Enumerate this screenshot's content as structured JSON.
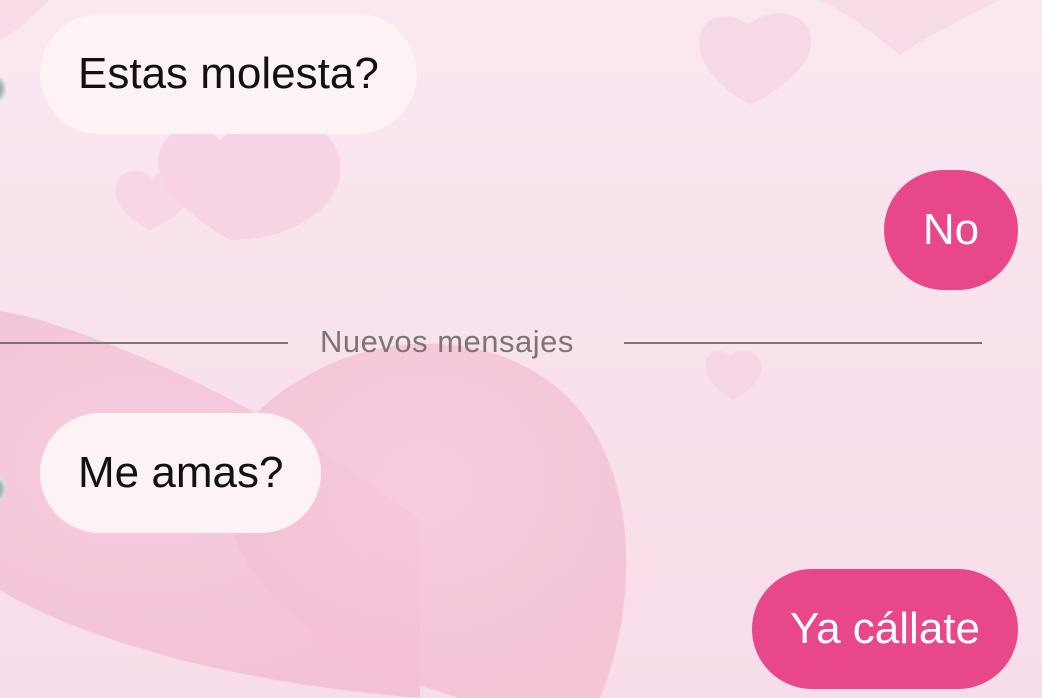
{
  "chat": {
    "messages": [
      {
        "direction": "incoming",
        "text": "Estas molesta?"
      },
      {
        "direction": "outgoing",
        "text": "No"
      },
      {
        "direction": "incoming",
        "text": "Me amas?"
      },
      {
        "direction": "outgoing",
        "text": "Ya cállate"
      }
    ],
    "new_messages_divider": "Nuevos mensajes"
  },
  "theme": {
    "background": "#f9e3ee",
    "incoming_bubble": "#fdf3f5",
    "outgoing_bubble": "#e8488a",
    "divider_color": "#7c7479",
    "wallpaper_icon": "heart-icon"
  }
}
